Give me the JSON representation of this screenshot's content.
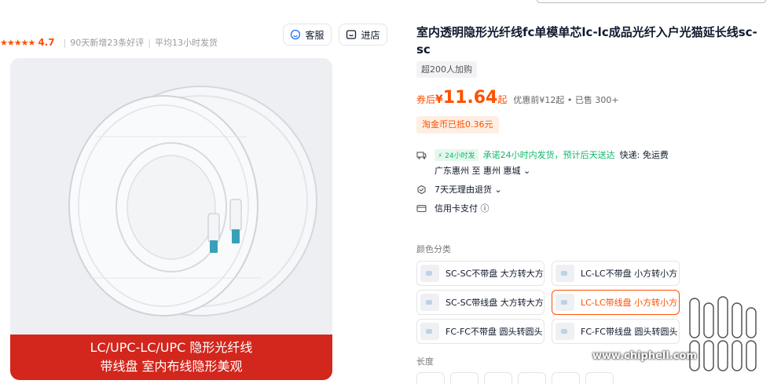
{
  "rating": {
    "stars": "★★★★★",
    "score": "4.7",
    "stat1": "90天新增23条好评",
    "stat2": "平均13小时发货"
  },
  "buttons": {
    "service": "客服",
    "shop": "进店"
  },
  "image": {
    "banner_line1": "LC/UPC-LC/UPC 隐形光纤线",
    "banner_line2": "带线盘 室内布线隐形美观"
  },
  "product": {
    "title": "室内透明隐形光纤线fc单模单芯lc-lc成品光纤入户光猫延长线sc-sc",
    "join": "超200人加购",
    "price_label": "券后",
    "currency": "¥",
    "price": "11.64",
    "price_suffix": "起",
    "price_extra": "优惠前¥12起 • 已售 300+",
    "coin": "淘金币已抵0.36元"
  },
  "shipping": {
    "tag": "⚡ 24小时发",
    "promise": "承诺24小时内发货，预计后天送达",
    "express": "快递: 免运费",
    "route": "广东惠州 至 惠州 惠城 ⌄"
  },
  "returns": "7天无理由退货 ⌄",
  "credit": "信用卡支付 ⓘ",
  "color_label": "颜色分类",
  "options": [
    "SC-SC不带盘 大方转大方",
    "LC-LC不带盘 小方转小方",
    "SC-SC带线盘 大方转大方",
    "LC-LC带线盘 小方转小方",
    "FC-FC不带盘 圆头转圆头",
    "FC-FC带线盘 圆头转圆头"
  ],
  "length_label": "长度",
  "watermark": "www.chiphell.com"
}
